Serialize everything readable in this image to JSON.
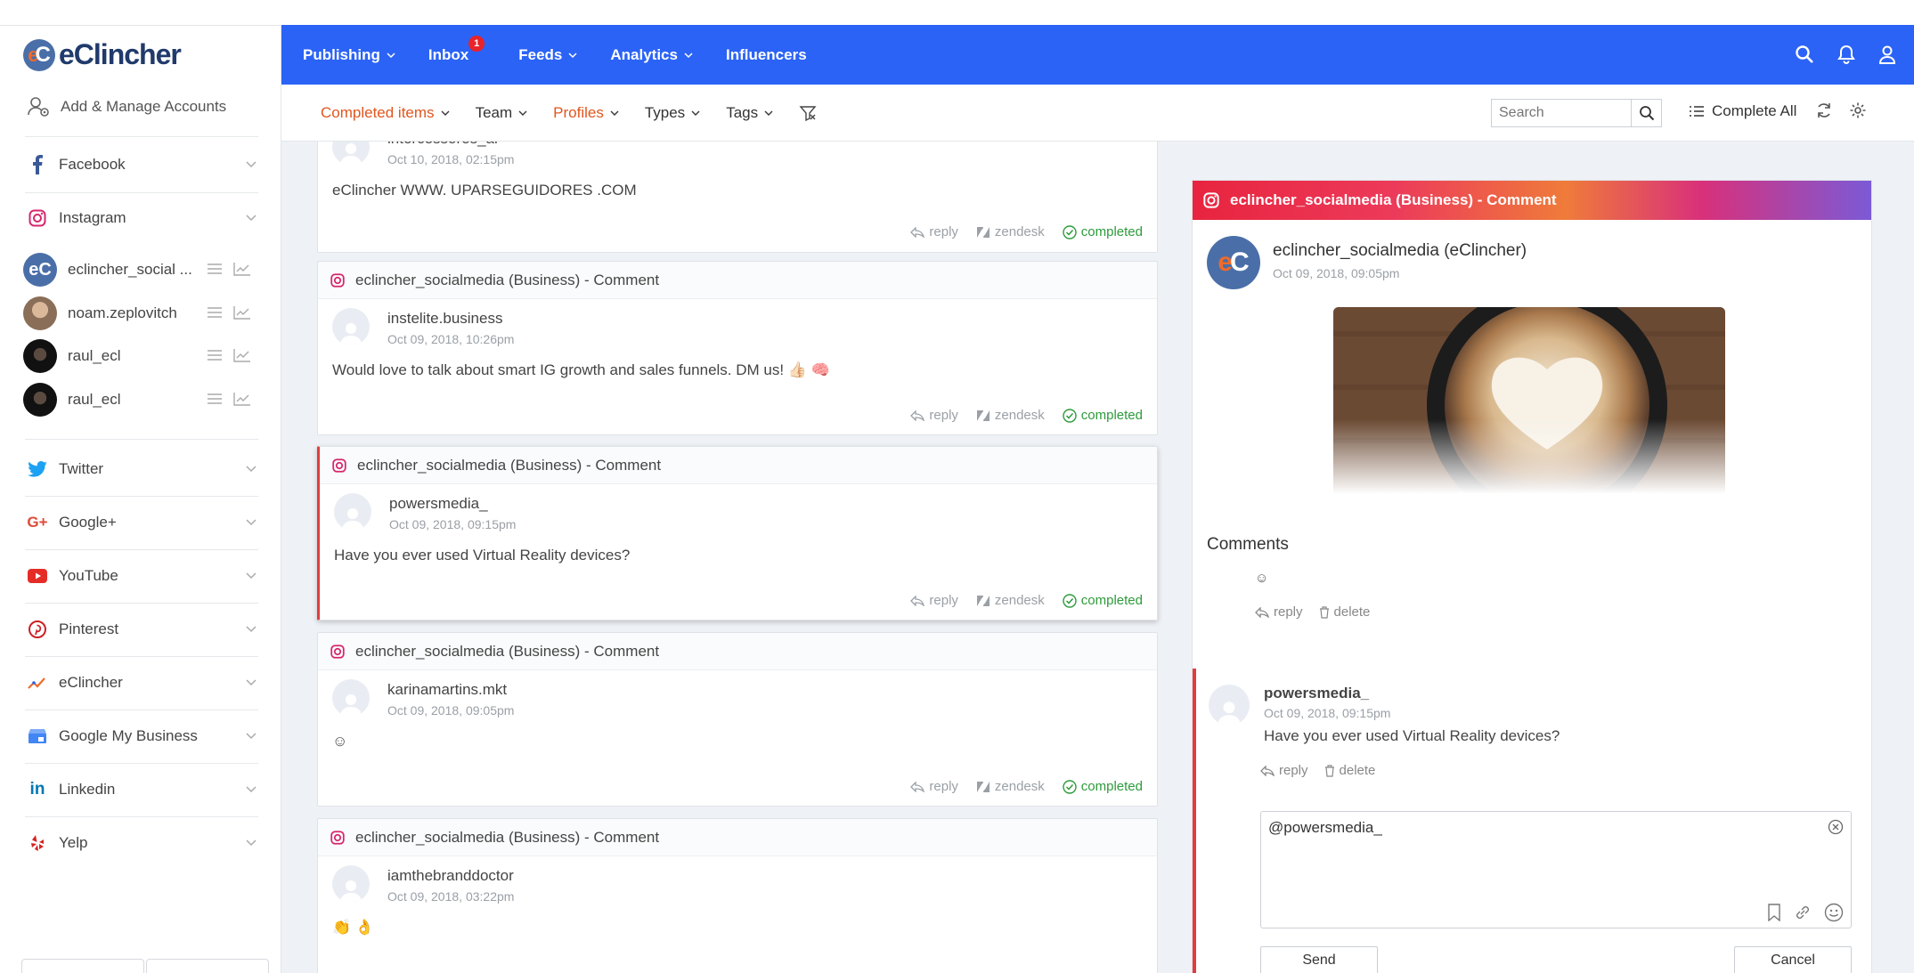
{
  "brand": {
    "name": "eClincher"
  },
  "sidebar": {
    "add_accounts": "Add & Manage Accounts",
    "networks": [
      {
        "label": "Facebook",
        "icon": "facebook-icon"
      },
      {
        "label": "Instagram",
        "icon": "instagram-icon"
      },
      {
        "label": "Twitter",
        "icon": "twitter-icon"
      },
      {
        "label": "Google+",
        "icon": "google-plus-icon"
      },
      {
        "label": "YouTube",
        "icon": "youtube-icon"
      },
      {
        "label": "Pinterest",
        "icon": "pinterest-icon"
      },
      {
        "label": "eClincher",
        "icon": "eclincher-icon"
      },
      {
        "label": "Google My Business",
        "icon": "google-my-business-icon"
      },
      {
        "label": "Linkedin",
        "icon": "linkedin-icon"
      },
      {
        "label": "Yelp",
        "icon": "yelp-icon"
      }
    ],
    "instagram_accounts": [
      {
        "name": "eclincher_social ..."
      },
      {
        "name": "noam.zeplovitch"
      },
      {
        "name": "raul_ecl"
      },
      {
        "name": "raul_ecl"
      }
    ]
  },
  "topnav": {
    "items": [
      {
        "label": "Publishing"
      },
      {
        "label": "Inbox",
        "badge": "1"
      },
      {
        "label": "Feeds"
      },
      {
        "label": "Analytics"
      },
      {
        "label": "Influencers"
      }
    ]
  },
  "filters": {
    "completed": "Completed items",
    "team": "Team",
    "profiles": "Profiles",
    "types": "Types",
    "tags": "Tags",
    "search_placeholder": "Search",
    "complete_all": "Complete All"
  },
  "feed": {
    "action_reply": "reply",
    "action_zendesk": "zendesk",
    "action_completed": "completed",
    "cards": [
      {
        "header": "",
        "author": "intercessores_al",
        "date": "Oct 10, 2018, 02:15pm",
        "message": "eClincher WWW. UPARSEGUIDORES .COM"
      },
      {
        "header": "eclincher_socialmedia (Business) - Comment",
        "author": "instelite.business",
        "date": "Oct 09, 2018, 10:26pm",
        "message": "Would love to talk about smart IG growth and sales funnels. DM us! 👍🏻 🧠"
      },
      {
        "header": "eclincher_socialmedia (Business) - Comment",
        "author": "powersmedia_",
        "date": "Oct 09, 2018, 09:15pm",
        "message": "Have you ever used Virtual Reality devices?"
      },
      {
        "header": "eclincher_socialmedia (Business) - Comment",
        "author": "karinamartins.mkt",
        "date": "Oct 09, 2018, 09:05pm",
        "message": "☺"
      },
      {
        "header": "eclincher_socialmedia (Business) - Comment",
        "author": "iamthebranddoctor",
        "date": "Oct 09, 2018, 03:22pm",
        "message": "👏 👌"
      }
    ]
  },
  "detail": {
    "header": "eclincher_socialmedia (Business) - Comment",
    "post_author": "eclincher_socialmedia (eClincher)",
    "post_date": "Oct 09, 2018, 09:05pm",
    "comments_title": "Comments",
    "partial_comment_text": "☺",
    "action_reply": "reply",
    "action_delete": "delete",
    "selected": {
      "author": "powersmedia_",
      "date": "Oct 09, 2018, 09:15pm",
      "text": "Have you ever used Virtual Reality devices?"
    },
    "reply_value": "@powersmedia_ ",
    "send_label": "Send",
    "cancel_label": "Cancel"
  }
}
